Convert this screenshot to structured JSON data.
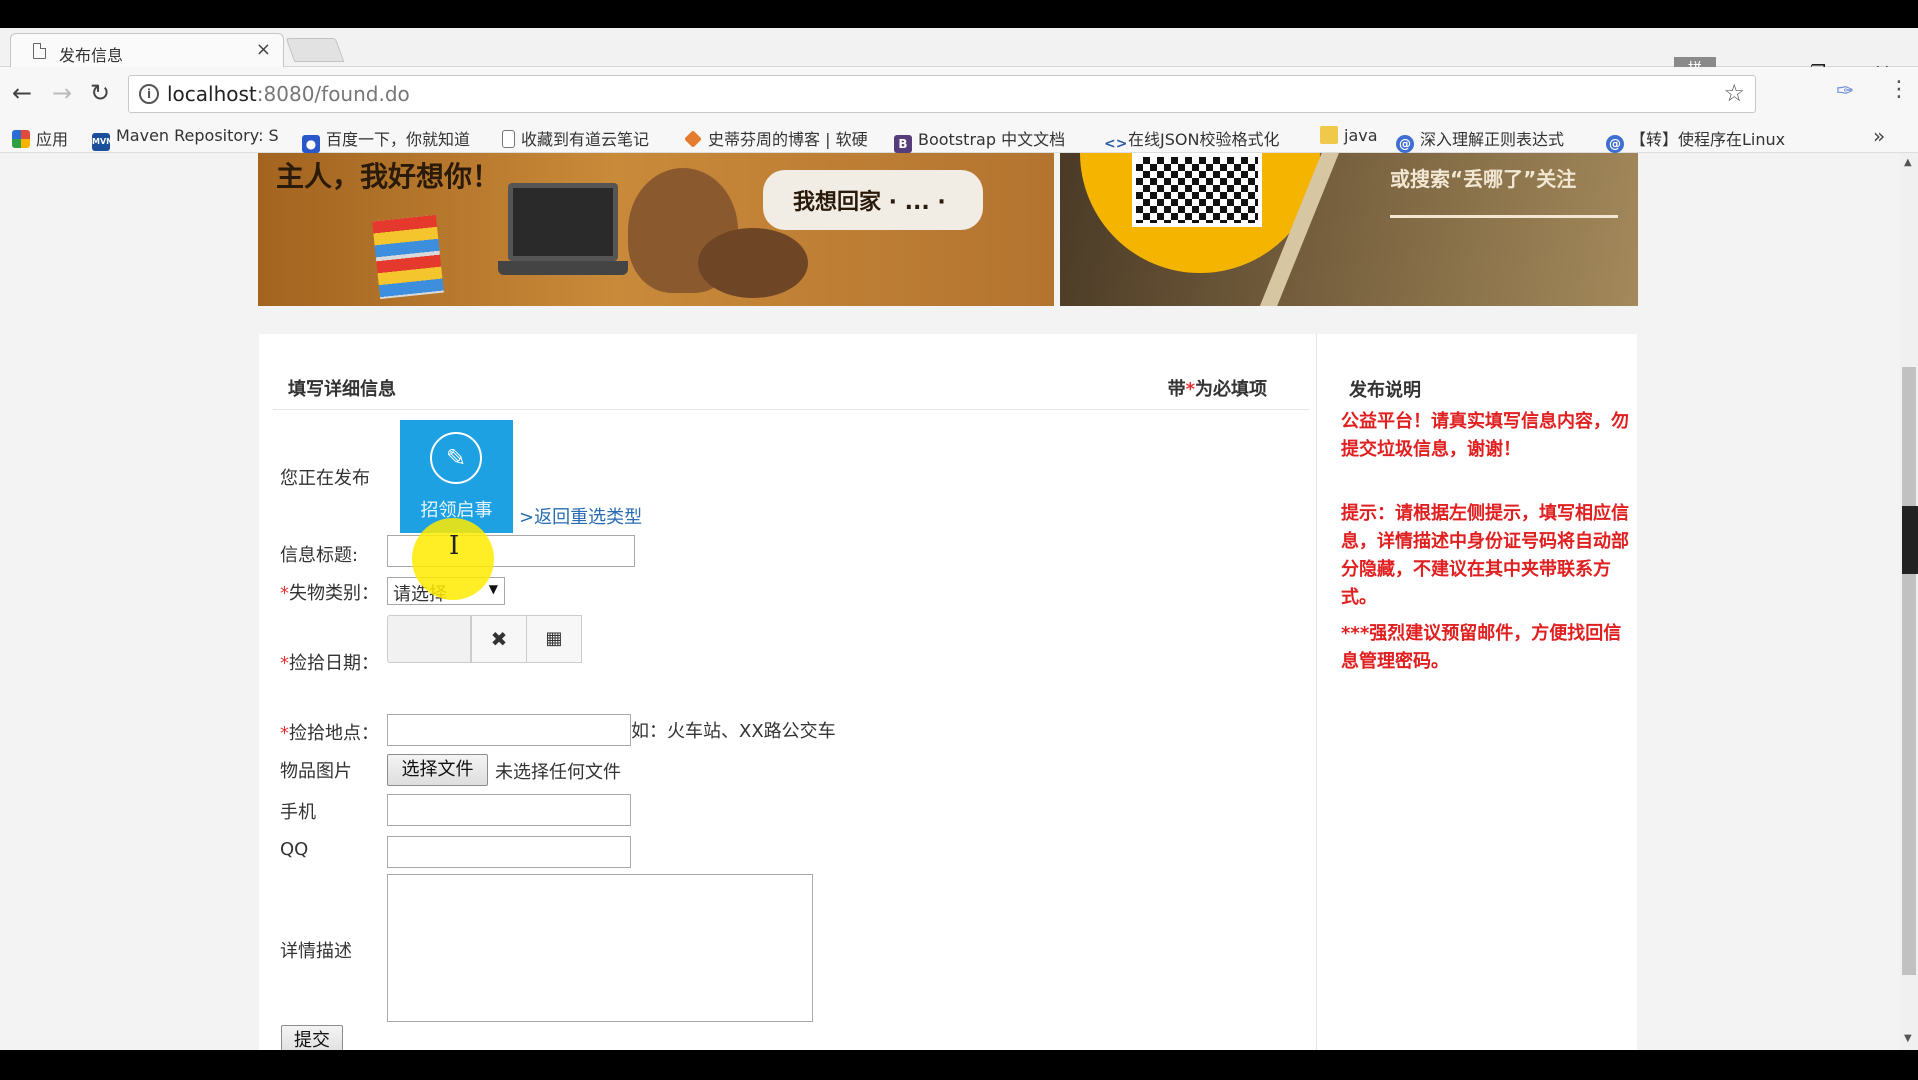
{
  "browser": {
    "tab_title": "发布信息",
    "tab_close": "×",
    "url_host": "localhost",
    "url_path": ":8080/found.do",
    "ime_label": "拼",
    "bookmarks": [
      {
        "label": "应用",
        "icon": "apps-grid-icon",
        "color": "#e04a3a"
      },
      {
        "label": "Maven Repository: S",
        "icon": "maven-icon",
        "color": "#1b4f9c"
      },
      {
        "label": "百度一下，你就知道",
        "icon": "baidu-paw-icon",
        "color": "#2b58c9"
      },
      {
        "label": "收藏到有道云笔记",
        "icon": "page-icon",
        "color": "#888888"
      },
      {
        "label": "史蒂芬周的博客 | 软硬",
        "icon": "blog-icon",
        "color": "#e57b2e"
      },
      {
        "label": "Bootstrap 中文文档",
        "icon": "bootstrap-icon",
        "color": "#563d7c"
      },
      {
        "label": "在线JSON校验格式化",
        "icon": "json-icon",
        "color": "#2c5fab"
      },
      {
        "label": "java",
        "icon": "folder-icon",
        "color": "#f0c84a"
      },
      {
        "label": "深入理解正则表达式",
        "icon": "regex-icon",
        "color": "#3f6fd1"
      },
      {
        "label": "【转】使程序在Linux",
        "icon": "cnblogs-icon",
        "color": "#3f6fd1"
      }
    ]
  },
  "banner": {
    "slogan": "主人，我好想你！",
    "bubble": "我想回家 · ... ·",
    "follow_text": "或搜索“丢哪了”关注"
  },
  "form": {
    "section_title": "填写详细信息",
    "required_note_prefix": "带",
    "required_star": "*",
    "required_note_suffix": "为必填项",
    "publishing_label": "您正在发布",
    "type_name": "招领启事",
    "reselect_link": ">返回重选类型",
    "title_label": "信息标题:",
    "category_label": "失物类别：",
    "category_value": "请选择",
    "date_label": "捡拾日期：",
    "location_label": "捡拾地点：",
    "location_hint": "如：火车站、XX路公交车",
    "image_label": "物品图片",
    "file_button": "选择文件",
    "file_status": "未选择任何文件",
    "phone_label": "手机",
    "qq_label": "QQ",
    "description_label": "详情描述",
    "submit_label": "提交"
  },
  "side": {
    "title": "发布说明",
    "notice1": "公益平台！请真实填写信息内容，勿提交垃圾信息，谢谢！",
    "notice2": "提示：请根据左侧提示，填写相应信息，详情描述中身份证号码将自动部分隐藏，不建议在其中夹带联系方式。",
    "notice3": "***强烈建议预留邮件，方便找回信息管理密码。"
  }
}
